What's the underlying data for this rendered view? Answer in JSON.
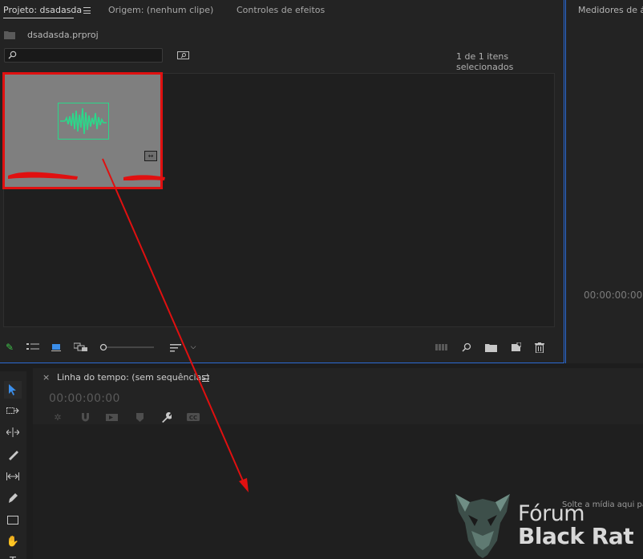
{
  "project_panel": {
    "tabs": [
      {
        "label": "Projeto: dsadasda"
      },
      {
        "label": "Origem: (nenhum clipe)"
      },
      {
        "label": "Controles de efeitos"
      }
    ],
    "project_file": "dsadasda.prproj",
    "search_placeholder": "",
    "selection_status": "1 de 1 itens selecionados",
    "clip": {
      "name": "",
      "selected": true
    }
  },
  "meters_panel": {
    "tab_label": "Medidores de áu",
    "timecode": "00:00:00:00"
  },
  "timeline": {
    "title": "Linha do tempo: (sem sequências)",
    "timecode": "00:00:00:00",
    "drop_hint": "Solte a mídia aqui pa"
  },
  "watermark": {
    "line1": "Fórum",
    "line2": "Black Rat"
  },
  "colors": {
    "accent_blue": "#2c6bd4",
    "selection_red": "#e01010",
    "waveform_green": "#2bd88a"
  }
}
